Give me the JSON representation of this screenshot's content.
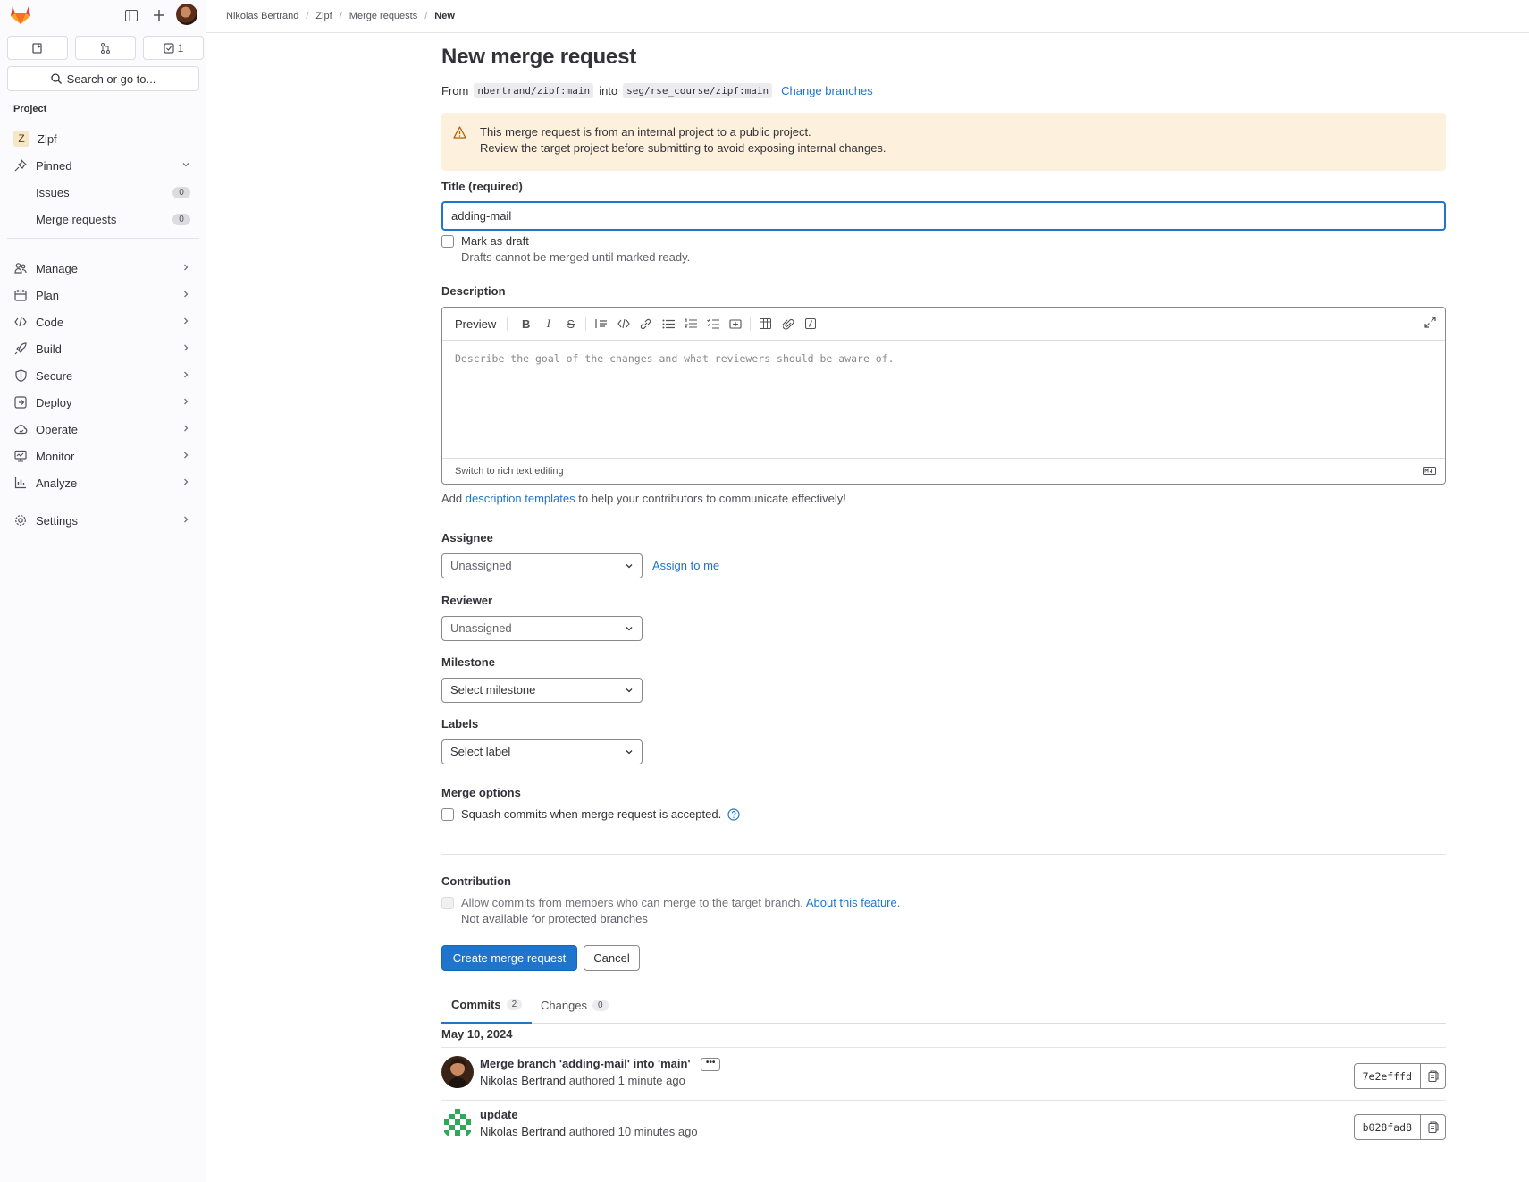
{
  "sidebar": {
    "counts": {
      "issues_icon": "issues-icon",
      "mr_icon": "merge-request-icon",
      "todos": "1"
    },
    "search_label": "Search or go to...",
    "section_label": "Project",
    "project": {
      "initial": "Z",
      "name": "Zipf"
    },
    "pinned": {
      "label": "Pinned",
      "items": [
        {
          "label": "Issues",
          "count": "0"
        },
        {
          "label": "Merge requests",
          "count": "0"
        }
      ]
    },
    "groups": [
      {
        "label": "Manage",
        "icon": "users-icon"
      },
      {
        "label": "Plan",
        "icon": "calendar-icon"
      },
      {
        "label": "Code",
        "icon": "code-icon"
      },
      {
        "label": "Build",
        "icon": "rocket-icon"
      },
      {
        "label": "Secure",
        "icon": "shield-icon"
      },
      {
        "label": "Deploy",
        "icon": "deploy-icon"
      },
      {
        "label": "Operate",
        "icon": "cloud-icon"
      },
      {
        "label": "Monitor",
        "icon": "monitor-icon"
      },
      {
        "label": "Analyze",
        "icon": "chart-icon"
      }
    ],
    "settings": {
      "label": "Settings",
      "icon": "gear-icon"
    }
  },
  "breadcrumb": [
    "Nikolas Bertrand",
    "Zipf",
    "Merge requests",
    "New"
  ],
  "page": {
    "title": "New merge request",
    "from_label": "From",
    "source_branch": "nbertrand/zipf:main",
    "into_label": "into",
    "target_branch": "seg/rse_course/zipf:main",
    "change_branches": "Change branches"
  },
  "alert": {
    "line1": "This merge request is from an internal project to a public project.",
    "line2": "Review the target project before submitting to avoid exposing internal changes."
  },
  "form": {
    "title_label": "Title (required)",
    "title_value": "adding-mail",
    "draft_label": "Mark as draft",
    "draft_help": "Drafts cannot be merged until marked ready.",
    "description_label": "Description",
    "preview_label": "Preview",
    "description_placeholder": "Describe the goal of the changes and what reviewers should be aware of.",
    "rich_text_toggle": "Switch to rich text editing",
    "templates_prefix": "Add",
    "templates_link": "description templates",
    "templates_suffix": "to help your contributors to communicate effectively!",
    "assignee_label": "Assignee",
    "assignee_value": "Unassigned",
    "assign_to_me": "Assign to me",
    "reviewer_label": "Reviewer",
    "reviewer_value": "Unassigned",
    "milestone_label": "Milestone",
    "milestone_value": "Select milestone",
    "labels_label": "Labels",
    "labels_value": "Select label",
    "merge_options_label": "Merge options",
    "squash_label": "Squash commits when merge request is accepted.",
    "contribution_label": "Contribution",
    "contribution_text": "Allow commits from members who can merge to the target branch.",
    "about_feature": "About this feature.",
    "contribution_help": "Not available for protected branches",
    "create_button": "Create merge request",
    "cancel_button": "Cancel"
  },
  "tabs": [
    {
      "label": "Commits",
      "count": "2"
    },
    {
      "label": "Changes",
      "count": "0"
    }
  ],
  "commits": {
    "date": "May 10, 2024",
    "items": [
      {
        "message": "Merge branch 'adding-mail' into 'main'",
        "author": "Nikolas Bertrand",
        "authored": "authored 1 minute ago",
        "sha": "7e2efffd"
      },
      {
        "message": "update",
        "author": "Nikolas Bertrand",
        "authored": "authored 10 minutes ago",
        "sha": "b028fad8"
      }
    ]
  },
  "colors": {
    "accent": "#1f75cb",
    "alert_bg": "#fdf1dd",
    "logo": "#e24329"
  }
}
